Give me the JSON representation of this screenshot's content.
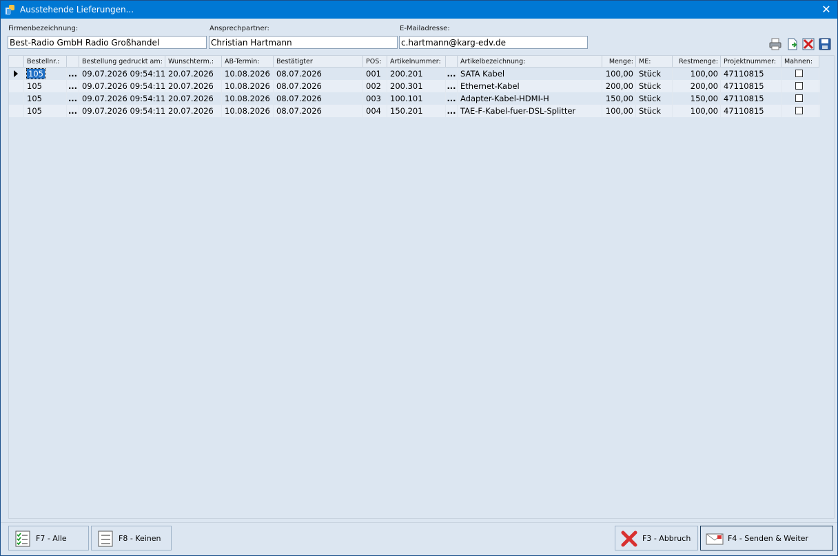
{
  "window": {
    "title": "Ausstehende Lieferungen...",
    "close_glyph": "✕"
  },
  "form": {
    "firma_label": "Firmenbezeichnung:",
    "firma_value": "Best-Radio GmbH Radio Großhandel",
    "ansprech_label": "Ansprechpartner:",
    "ansprech_value": "Christian Hartmann",
    "email_label": "E-Mailadresse:",
    "email_value": "c.hartmann@karg-edv.de"
  },
  "toolbar": [
    "printer-icon",
    "export-document-icon",
    "delete-icon",
    "save-disk-icon"
  ],
  "table": {
    "headers": {
      "bestellnr": "Bestellnr.:",
      "gedruckt": "Bestellung gedruckt am:",
      "wunsch": "Wunschterm.:",
      "ab": "AB-Termin:",
      "bestaetigt": "Bestätigter",
      "pos": "POS:",
      "artnr": "Artikelnummer:",
      "artbez": "Artikelbezeichnung:",
      "menge": "Menge:",
      "me": "ME:",
      "rest": "Restmenge:",
      "projekt": "Projektnummer:",
      "mahnen": "Mahnen:"
    },
    "ellipsis": "...",
    "rows": [
      {
        "bestellnr": "105",
        "gedruckt": "09.07.2026 09:54:11",
        "wunsch": "20.07.2026",
        "ab": "10.08.2026",
        "bestaetigt": "08.07.2026",
        "pos": "001",
        "artnr": "200.201",
        "artbez": "SATA Kabel",
        "menge": "100,00",
        "me": "Stück",
        "rest": "100,00",
        "projekt": "47110815",
        "mahnen": false
      },
      {
        "bestellnr": "105",
        "gedruckt": "09.07.2026 09:54:11",
        "wunsch": "20.07.2026",
        "ab": "10.08.2026",
        "bestaetigt": "08.07.2026",
        "pos": "002",
        "artnr": "200.301",
        "artbez": "Ethernet-Kabel",
        "menge": "200,00",
        "me": "Stück",
        "rest": "200,00",
        "projekt": "47110815",
        "mahnen": false
      },
      {
        "bestellnr": "105",
        "gedruckt": "09.07.2026 09:54:11",
        "wunsch": "20.07.2026",
        "ab": "10.08.2026",
        "bestaetigt": "08.07.2026",
        "pos": "003",
        "artnr": "100.101",
        "artbez": "Adapter-Kabel-HDMI-H",
        "menge": "150,00",
        "me": "Stück",
        "rest": "150,00",
        "projekt": "47110815",
        "mahnen": false
      },
      {
        "bestellnr": "105",
        "gedruckt": "09.07.2026 09:54:11",
        "wunsch": "20.07.2026",
        "ab": "10.08.2026",
        "bestaetigt": "08.07.2026",
        "pos": "004",
        "artnr": "150.201",
        "artbez": "TAE-F-Kabel-fuer-DSL-Splitter",
        "menge": "100,00",
        "me": "Stück",
        "rest": "100,00",
        "projekt": "47110815",
        "mahnen": false
      }
    ]
  },
  "buttons": {
    "alle": "F7 - Alle",
    "keinen": "F8 - Keinen",
    "abbruch": "F3 - Abbruch",
    "senden": "F4 - Senden & Weiter"
  }
}
